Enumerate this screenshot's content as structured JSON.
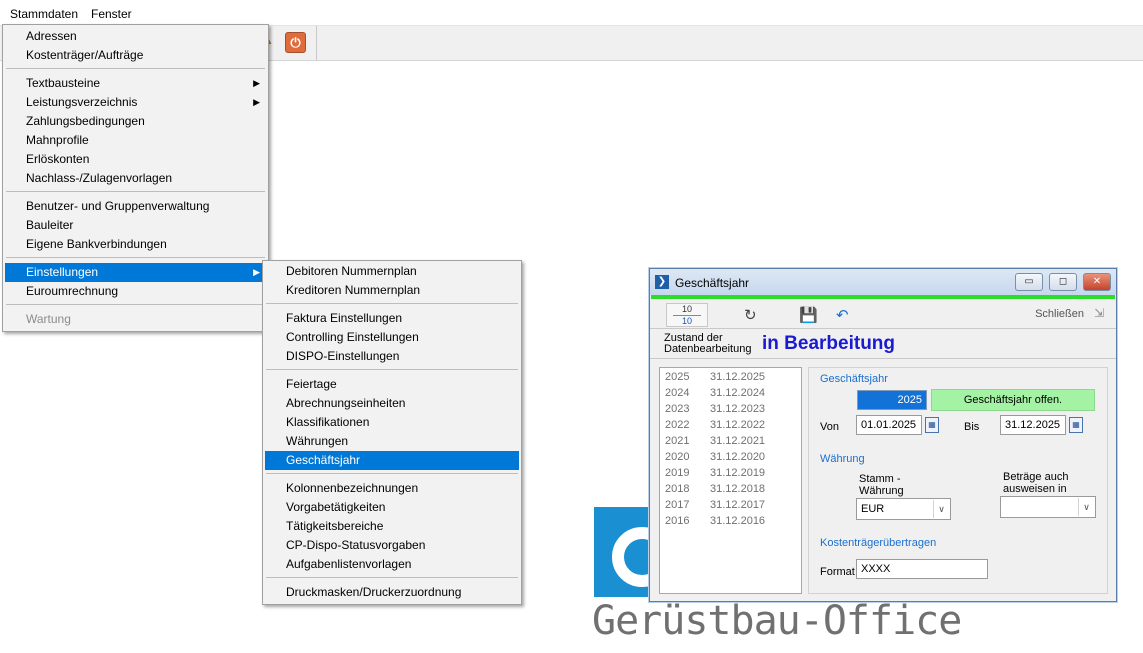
{
  "menubar": {
    "items": [
      "Stammdaten",
      "Fenster"
    ]
  },
  "stammdaten_menu": {
    "items": [
      {
        "label": "Adressen"
      },
      {
        "label": "Kostenträger/Aufträge"
      },
      {
        "label": "Textbausteine",
        "submenu": true
      },
      {
        "label": "Leistungsverzeichnis",
        "submenu": true
      },
      {
        "label": "Zahlungsbedingungen"
      },
      {
        "label": "Mahnprofile"
      },
      {
        "label": "Erlöskonten"
      },
      {
        "label": "Nachlass-/Zulagenvorlagen"
      },
      {
        "label": "Benutzer- und Gruppenverwaltung"
      },
      {
        "label": "Bauleiter"
      },
      {
        "label": "Eigene Bankverbindungen"
      },
      {
        "label": "Einstellungen",
        "submenu": true,
        "selected": true
      },
      {
        "label": "Euroumrechnung"
      },
      {
        "label": "Wartung",
        "disabled": true
      }
    ]
  },
  "einstellungen_menu": {
    "items": [
      {
        "label": "Debitoren Nummernplan"
      },
      {
        "label": "Kreditoren Nummernplan"
      },
      {
        "label": "Faktura Einstellungen"
      },
      {
        "label": "Controlling Einstellungen"
      },
      {
        "label": "DISPO-Einstellungen"
      },
      {
        "label": "Feiertage"
      },
      {
        "label": "Abrechnungseinheiten"
      },
      {
        "label": "Klassifikationen"
      },
      {
        "label": "Währungen"
      },
      {
        "label": "Geschäftsjahr",
        "selected": true
      },
      {
        "label": "Kolonnenbezeichnungen"
      },
      {
        "label": "Vorgabetätigkeiten"
      },
      {
        "label": "Tätigkeitsbereiche"
      },
      {
        "label": "CP-Dispo-Statusvorgaben"
      },
      {
        "label": "Aufgabenlistenvorlagen"
      },
      {
        "label": "Druckmasken/Druckerzuordnung"
      }
    ]
  },
  "logo": {
    "text": "Gerüstbau-Office",
    "color": "#1a8fd2"
  },
  "dialog": {
    "title": "Geschäftsjahr",
    "counter_top": "10",
    "counter_bottom": "10",
    "close_label": "Schließen",
    "state_label_1": "Zustand der",
    "state_label_2": "Datenbearbeitung",
    "state_value": "in Bearbeitung",
    "years": [
      {
        "year": "2025",
        "date": "31.12.2025"
      },
      {
        "year": "2024",
        "date": "31.12.2024"
      },
      {
        "year": "2023",
        "date": "31.12.2023"
      },
      {
        "year": "2022",
        "date": "31.12.2022"
      },
      {
        "year": "2021",
        "date": "31.12.2021"
      },
      {
        "year": "2020",
        "date": "31.12.2020"
      },
      {
        "year": "2019",
        "date": "31.12.2019"
      },
      {
        "year": "2018",
        "date": "31.12.2018"
      },
      {
        "year": "2017",
        "date": "31.12.2017"
      },
      {
        "year": "2016",
        "date": "31.12.2016"
      }
    ],
    "section_fiscal": "Geschäftsjahr",
    "year_value": "2025",
    "status_text": "Geschäftsjahr offen.",
    "von_label": "Von",
    "von_value": "01.01.2025",
    "bis_label": "Bis",
    "bis_value": "31.12.2025",
    "section_currency": "Währung",
    "stamm_label_1": "Stamm -",
    "stamm_label_2": "Währung",
    "stamm_value": "EUR",
    "show_label_1": "Beträge auch",
    "show_label_2": "ausweisen in",
    "show_value": "",
    "section_cost": "Kostenträgerübertragen",
    "format_label": "Format",
    "format_value": "XXXX"
  }
}
